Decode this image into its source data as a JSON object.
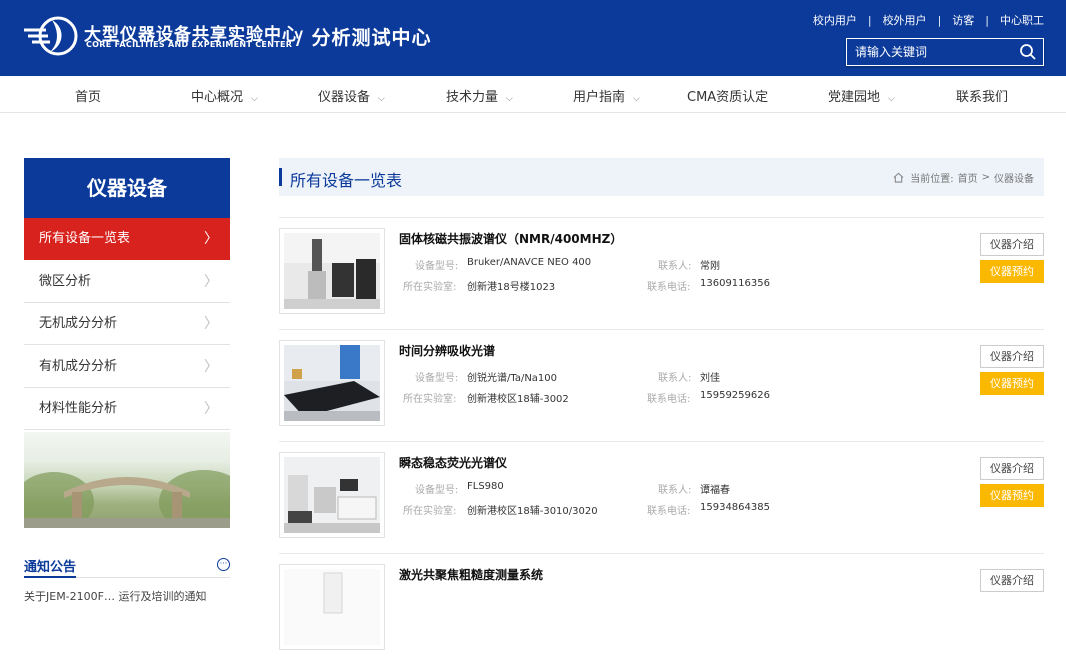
{
  "header": {
    "brand_cn": "大型仪器设备共享实验中心",
    "brand_en": "CORE FACILITIES AND EXPERIMENT CENTER",
    "brand_sub": "/ 分析测试中心",
    "top_links": [
      "校内用户",
      "校外用户",
      "访客",
      "中心职工"
    ],
    "search_placeholder": "请输入关键词"
  },
  "nav": [
    "首页",
    "中心概况",
    "仪器设备",
    "技术力量",
    "用户指南",
    "CMA资质认定",
    "党建园地",
    "联系我们"
  ],
  "sidebar": {
    "title": "仪器设备",
    "items": [
      "所有设备一览表",
      "微区分析",
      "无机成分分析",
      "有机成分分析",
      "材料性能分析"
    ],
    "active_index": 0
  },
  "notice": {
    "title": "通知公告",
    "first_item": "关于JEM-2100F… 运行及培训的通知"
  },
  "main": {
    "title": "所有设备一览表",
    "breadcrumb_prefix": "当前位置:",
    "breadcrumb": [
      "首页",
      "仪器设备"
    ],
    "breadcrumb_sep": ">",
    "labels": {
      "model": "设备型号:",
      "lab": "所在实验室:",
      "contact": "联系人:",
      "phone": "联系电话:"
    },
    "intro_button": "仪器介绍",
    "book_button": "仪器预约",
    "equipment": [
      {
        "name": "固体核磁共振波谱仪（NMR/400MHZ）",
        "model": "Bruker/ANAVCE NEO 400",
        "lab": "创新港18号楼1023",
        "contact": "常刚",
        "phone": "13609116356"
      },
      {
        "name": "时间分辨吸收光谱",
        "model": "创锐光谱/Ta/Na100",
        "lab": "创新港校区18辅-3002",
        "contact": "刘佳",
        "phone": "15959259626"
      },
      {
        "name": "瞬态稳态荧光光谱仪",
        "model": "FLS980",
        "lab": "创新港校区18辅-3010/3020",
        "contact": "谭福春",
        "phone": "15934864385"
      },
      {
        "name": "激光共聚焦粗糙度测量系统",
        "model": "",
        "lab": "",
        "contact": "",
        "phone": ""
      }
    ]
  },
  "colors": {
    "brand_blue": "#0b3a9a",
    "active_red": "#d7221e",
    "book_yellow": "#fbb800"
  }
}
